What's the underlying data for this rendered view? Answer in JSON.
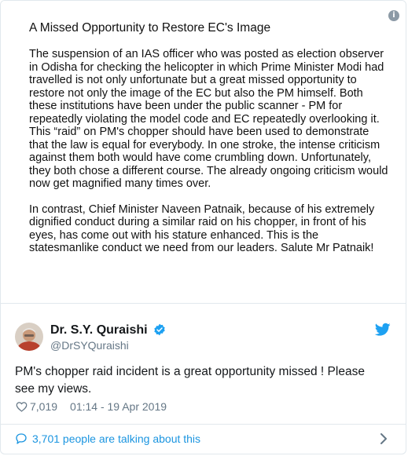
{
  "colors": {
    "link": "#1b95e0",
    "verified": "#1da1f2",
    "text": "#14171a",
    "muted": "#657786",
    "border": "#e1e8ed"
  },
  "attached_note": {
    "info_glyph": "i",
    "title": "A Missed Opportunity to Restore EC's Image",
    "paragraph1": [
      "The suspension of an IAS officer who was posted as election observer",
      "in Odisha for checking the helicopter in which Prime Minister Modi had",
      "travelled is not only unfortunate but a great missed opportunity to",
      "restore not only the image of the EC but also the PM himself. Both",
      "these institutions have been under the public scanner - PM for",
      "repeatedly violating the model code and EC repeatedly overlooking it.",
      "This “raid” on PM's chopper should have been used to demonstrate",
      "that the law is equal for everybody. In one stroke, the intense criticism",
      "against them both would have come crumbling down. Unfortunately,",
      "they both chose a different course. The already ongoing criticism would",
      "now get magnified many times over."
    ],
    "paragraph2": [
      "In contrast, Chief Minister Naveen Patnaik, because of his extremely",
      "dignified conduct  during a similar raid on his chopper, in front of his",
      "eyes,  has come out with his stature enhanced.  This is the",
      "statesmanlike conduct we need from our leaders. Salute Mr Patnaik!"
    ]
  },
  "author": {
    "display_name": "Dr. S.Y. Quraishi",
    "handle": "@DrSYQuraishi",
    "verified": true
  },
  "tweet": {
    "text_line1": "PM's chopper raid incident is a great opportunity missed ! Please",
    "text_line2": "see my views.",
    "likes": "7,019",
    "timestamp": "01:14 - 19 Apr 2019"
  },
  "footer": {
    "talking_text": "3,701 people are talking about this"
  },
  "icons": [
    "info-icon",
    "verified-icon",
    "twitter-bird-icon",
    "heart-icon",
    "speech-bubble-icon",
    "chevron-right-icon"
  ]
}
